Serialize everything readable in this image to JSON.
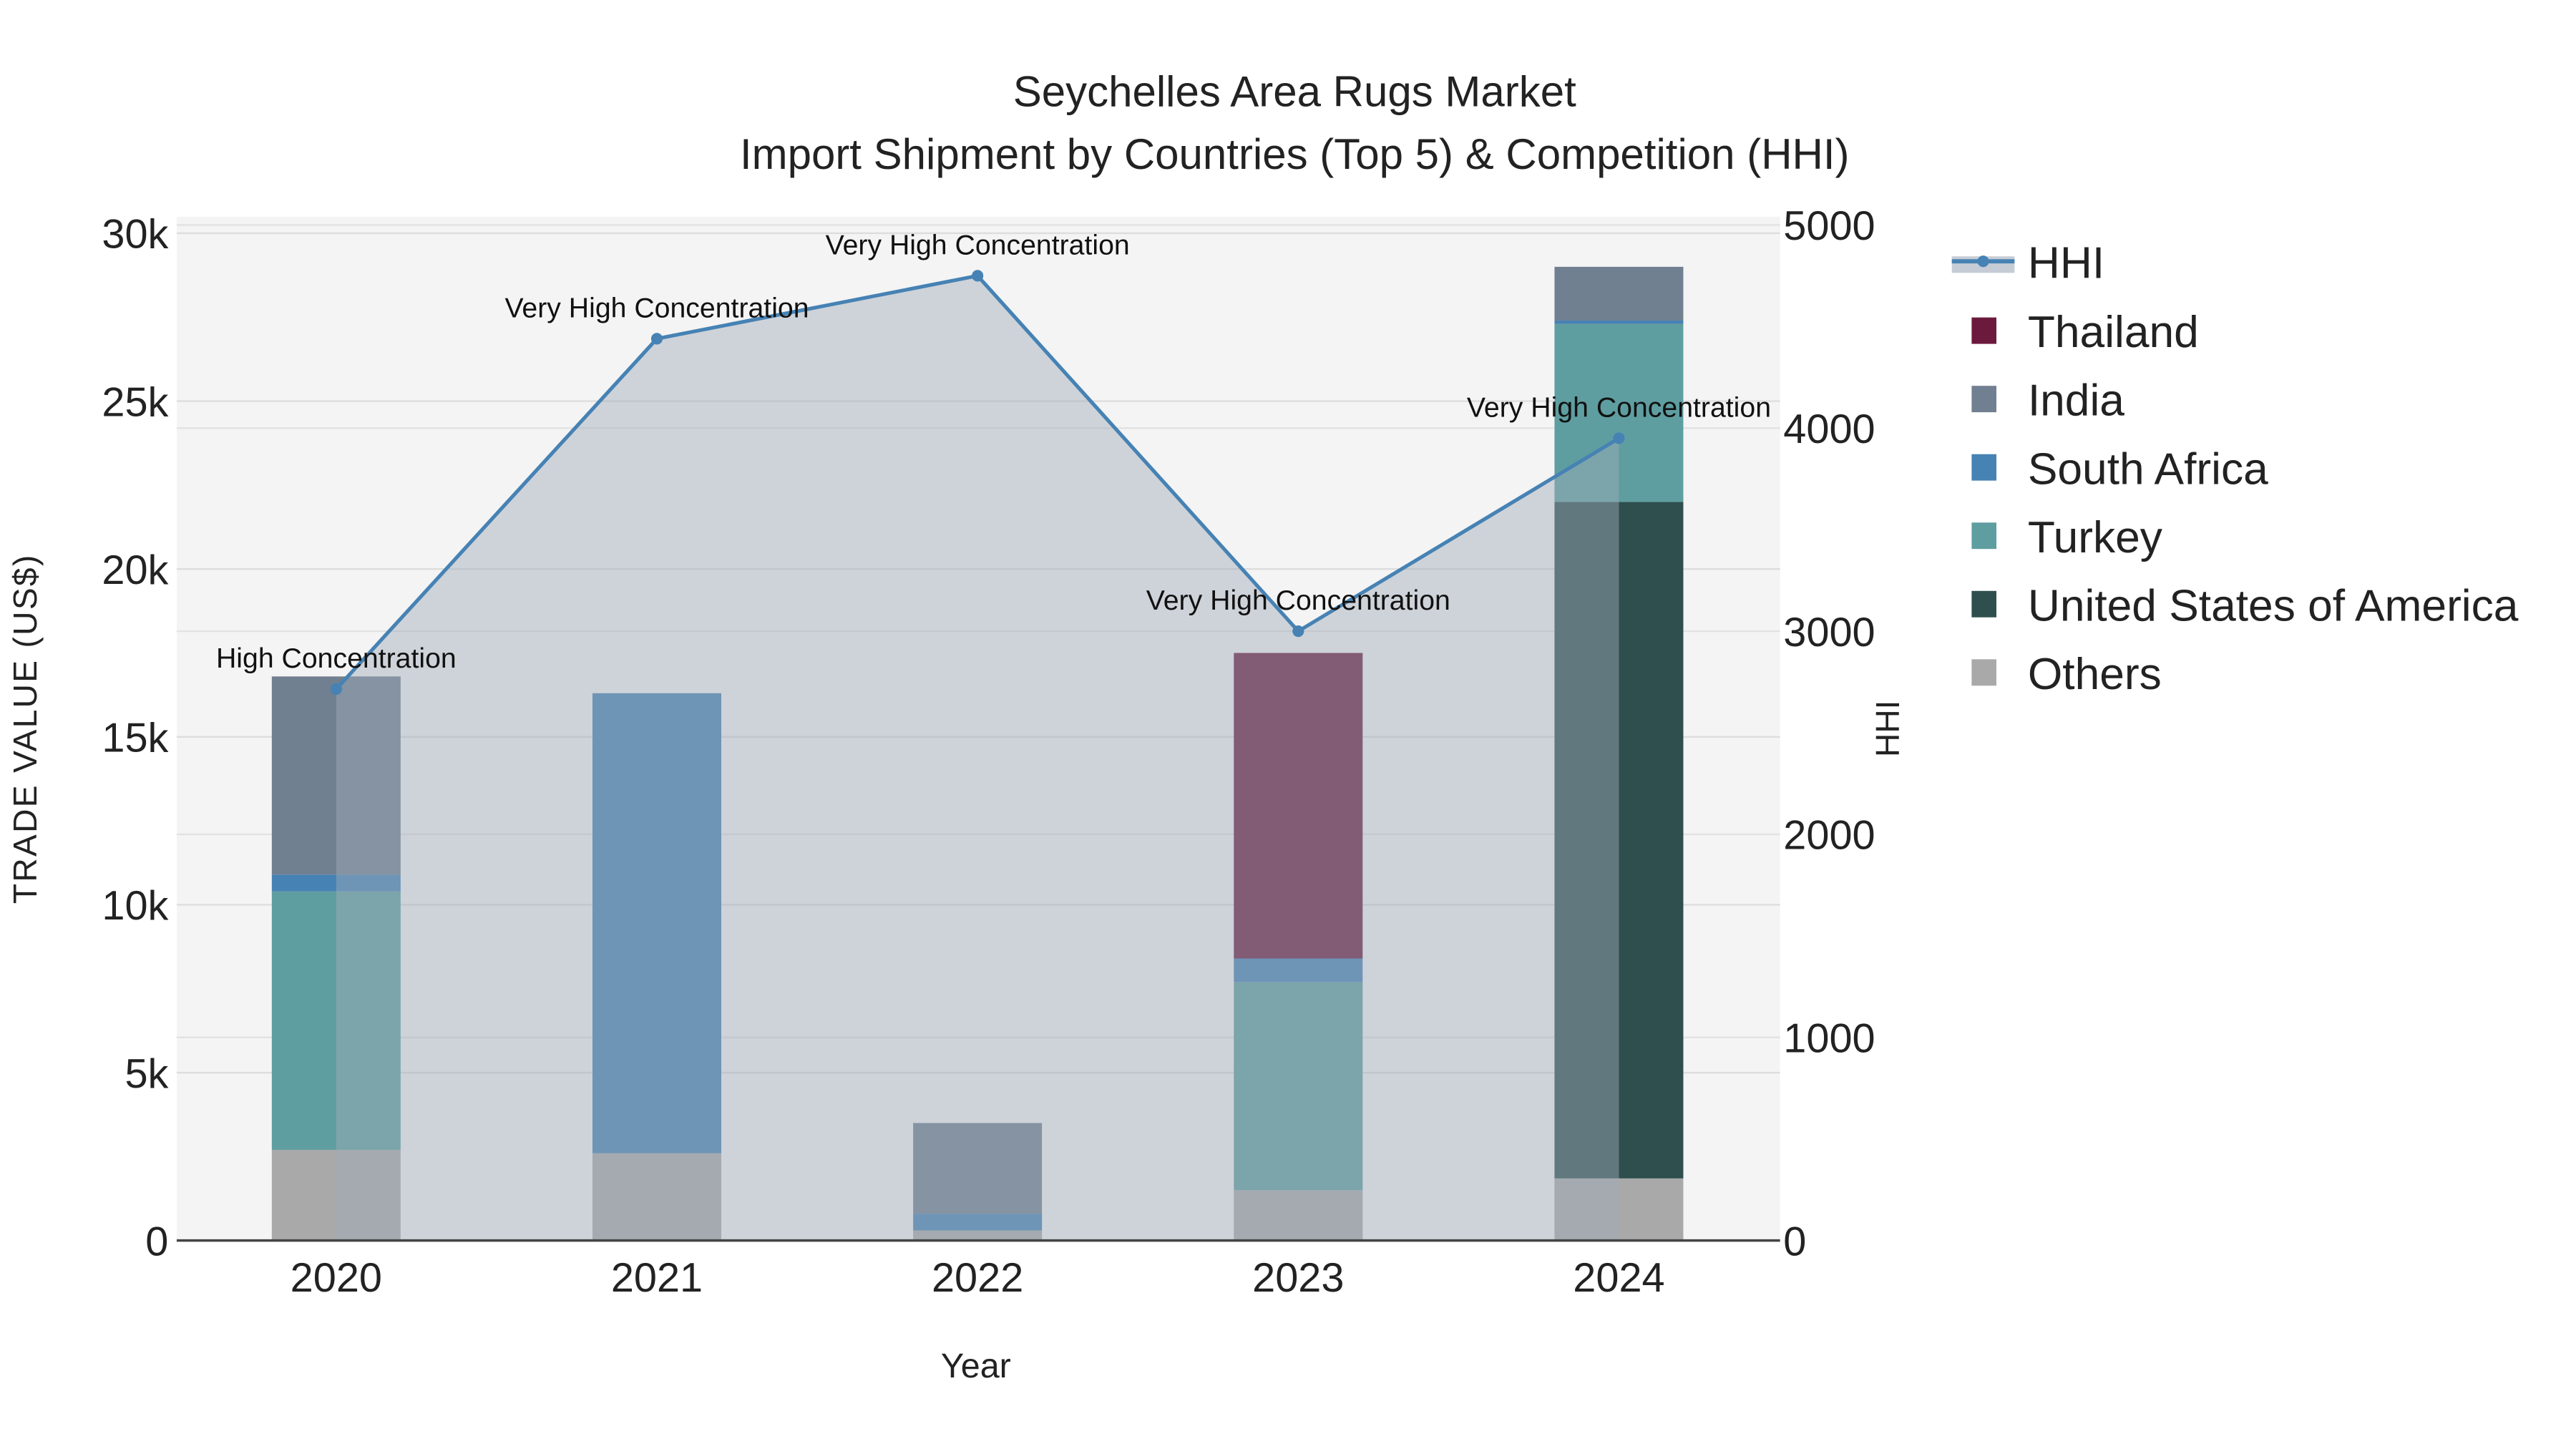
{
  "chart_data": {
    "type": "bar",
    "title": "Seychelles Area Rugs Market",
    "subtitle": "Import Shipment by Countries (Top 5) & Competition (HHI)",
    "xlabel": "Year",
    "ylabel": "TRADE VALUE (US$)",
    "y2label": "HHI",
    "categories": [
      "2020",
      "2021",
      "2022",
      "2023",
      "2024"
    ],
    "ylim": [
      0,
      30000
    ],
    "y2lim": [
      0,
      5000
    ],
    "yticks": [
      {
        "v": 0,
        "label": "0"
      },
      {
        "v": 5000,
        "label": "5k"
      },
      {
        "v": 10000,
        "label": "10k"
      },
      {
        "v": 15000,
        "label": "15k"
      },
      {
        "v": 20000,
        "label": "20k"
      },
      {
        "v": 25000,
        "label": "25k"
      },
      {
        "v": 30000,
        "label": "30k"
      }
    ],
    "y2ticks": [
      {
        "v": 0,
        "label": "0"
      },
      {
        "v": 1000,
        "label": "1000"
      },
      {
        "v": 2000,
        "label": "2000"
      },
      {
        "v": 3000,
        "label": "3000"
      },
      {
        "v": 4000,
        "label": "4000"
      },
      {
        "v": 5000,
        "label": "5000"
      }
    ],
    "grid": true,
    "legend_placement": "right",
    "stack_order": [
      "Others",
      "United States of America",
      "Turkey",
      "South Africa",
      "India",
      "Thailand"
    ],
    "series": [
      {
        "name": "Thailand",
        "color": "#6b1a3d",
        "values": [
          0,
          0,
          0,
          9100,
          0
        ]
      },
      {
        "name": "India",
        "color": "#708090",
        "values": [
          5900,
          0,
          2700,
          0,
          1600
        ]
      },
      {
        "name": "South Africa",
        "color": "#4682b4",
        "values": [
          500,
          13700,
          500,
          700,
          100
        ]
      },
      {
        "name": "Turkey",
        "color": "#5f9ea0",
        "values": [
          7700,
          0,
          0,
          6200,
          5300
        ]
      },
      {
        "name": "United States of America",
        "color": "#2f4f4f",
        "values": [
          0,
          0,
          0,
          0,
          20150
        ]
      },
      {
        "name": "Others",
        "color": "#a9a9a9",
        "values": [
          2700,
          2600,
          300,
          1500,
          1850
        ]
      }
    ],
    "hhi": {
      "name": "HHI",
      "color": "#4682b4",
      "values": [
        2715,
        4440,
        4750,
        3000,
        3950
      ],
      "annotations": [
        "High Concentration",
        "Very High Concentration",
        "Very High Concentration",
        "Very High Concentration",
        "Very High Concentration"
      ]
    }
  }
}
